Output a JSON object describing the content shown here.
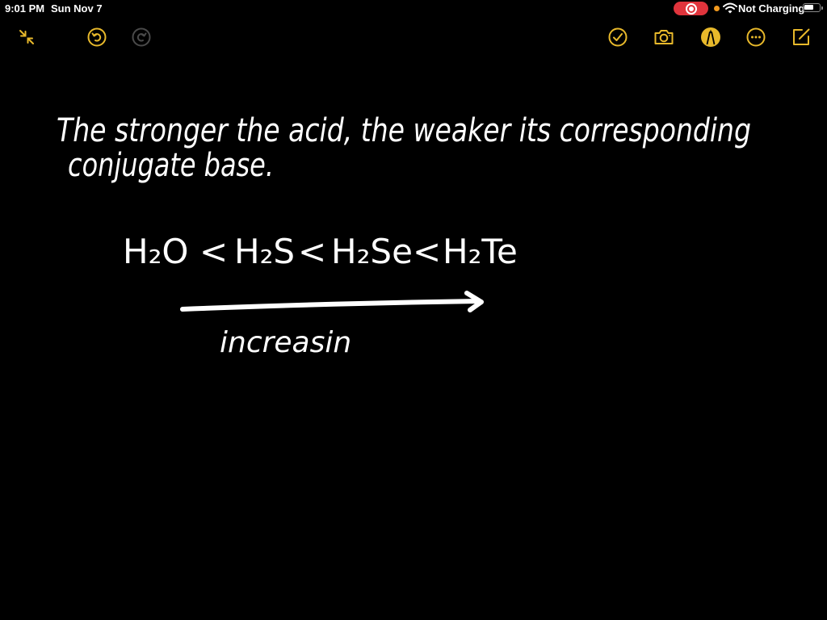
{
  "status_bar": {
    "time": "9:01 PM",
    "date": "Sun Nov 7",
    "charging_status": "Not Charging",
    "icons": [
      "screen-recording-icon",
      "microphone-indicator-icon",
      "wifi-icon",
      "battery-icon"
    ],
    "colors": {
      "recording": "#e0343c",
      "indicator": "#f29a1e"
    }
  },
  "toolbar": {
    "accent_color": "#e8b92b",
    "left_buttons": [
      {
        "name": "collapse",
        "icon": "collapse-arrows-icon"
      },
      {
        "name": "undo",
        "icon": "undo-icon"
      },
      {
        "name": "redo",
        "icon": "redo-icon",
        "disabled": true
      }
    ],
    "right_buttons": [
      {
        "name": "checklist",
        "icon": "checkmark-circle-icon"
      },
      {
        "name": "camera",
        "icon": "camera-icon"
      },
      {
        "name": "markup",
        "icon": "pencil-tip-icon",
        "active": true
      },
      {
        "name": "more",
        "icon": "ellipsis-circle-icon"
      },
      {
        "name": "compose",
        "icon": "compose-icon"
      }
    ]
  },
  "note": {
    "line1": "The stronger the acid, the weaker its corresponding",
    "line2": "conjugate base.",
    "formula": {
      "items": [
        "H₂O",
        "<",
        "H₂S",
        "<",
        "H₂Se",
        "<",
        "H₂Te"
      ]
    },
    "arrow_label": "increasin"
  }
}
